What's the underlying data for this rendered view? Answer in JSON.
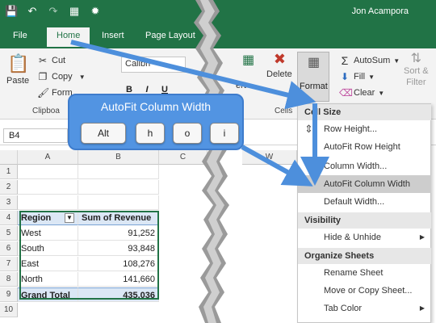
{
  "title_bar": {
    "user": "Jon Acampora",
    "qat_icons": [
      "save-icon",
      "undo-icon",
      "redo-icon",
      "folder-icon",
      "macro-icon"
    ]
  },
  "tabs": [
    "File",
    "Home",
    "Insert",
    "Page Layout"
  ],
  "active_tab": "Home",
  "ribbon": {
    "paste": "Paste",
    "cut": "Cut",
    "copy": "Copy",
    "format_painter": "Form",
    "clipboard_group": "Clipboa",
    "font_name": "Calibri",
    "font_buttons": [
      "B",
      "I",
      "U"
    ],
    "delete": "Delete",
    "insert_partial": "ert",
    "format": "Format",
    "cells_group": "Cells",
    "autosum": "AutoSum",
    "fill": "Fill",
    "clear": "Clear",
    "sort": "Sort &",
    "filter": "Filter"
  },
  "name_box": "B4",
  "columns": [
    "A",
    "B",
    "C",
    "W"
  ],
  "rows": [
    "1",
    "2",
    "3",
    "4",
    "5",
    "6",
    "7",
    "8",
    "9",
    "10"
  ],
  "pivot": {
    "header": [
      "Region",
      "Sum of Revenue"
    ],
    "rows": [
      {
        "region": "West",
        "value": "91,252"
      },
      {
        "region": "South",
        "value": "93,848"
      },
      {
        "region": "East",
        "value": "108,276"
      },
      {
        "region": "North",
        "value": "141,660"
      }
    ],
    "total": {
      "label": "Grand Total",
      "value": "435,036"
    }
  },
  "callout": {
    "title": "AutoFit Column Width",
    "keys": [
      "Alt",
      "h",
      "o",
      "i"
    ]
  },
  "menu": {
    "sections": [
      {
        "title": "Cell Size",
        "items": [
          {
            "label": "Row Height...",
            "icon": "row-height-icon",
            "highlight": false,
            "submenu": false
          },
          {
            "label": "AutoFit Row Height",
            "icon": "",
            "highlight": false,
            "submenu": false
          },
          {
            "label": "Column Width...",
            "icon": "column-width-icon",
            "highlight": false,
            "submenu": false
          },
          {
            "label": "AutoFit Column Width",
            "icon": "",
            "highlight": true,
            "submenu": false
          },
          {
            "label": "Default Width...",
            "icon": "",
            "highlight": false,
            "submenu": false
          }
        ]
      },
      {
        "title": "Visibility",
        "items": [
          {
            "label": "Hide & Unhide",
            "icon": "",
            "highlight": false,
            "submenu": true
          }
        ]
      },
      {
        "title": "Organize Sheets",
        "items": [
          {
            "label": "Rename Sheet",
            "icon": "",
            "highlight": false,
            "submenu": false
          },
          {
            "label": "Move or Copy Sheet...",
            "icon": "",
            "highlight": false,
            "submenu": false
          },
          {
            "label": "Tab Color",
            "icon": "",
            "highlight": false,
            "submenu": true
          }
        ]
      }
    ]
  },
  "colors": {
    "excel_green": "#217346",
    "callout_blue": "#5294e2",
    "pivot_header": "#dbe7f5"
  }
}
